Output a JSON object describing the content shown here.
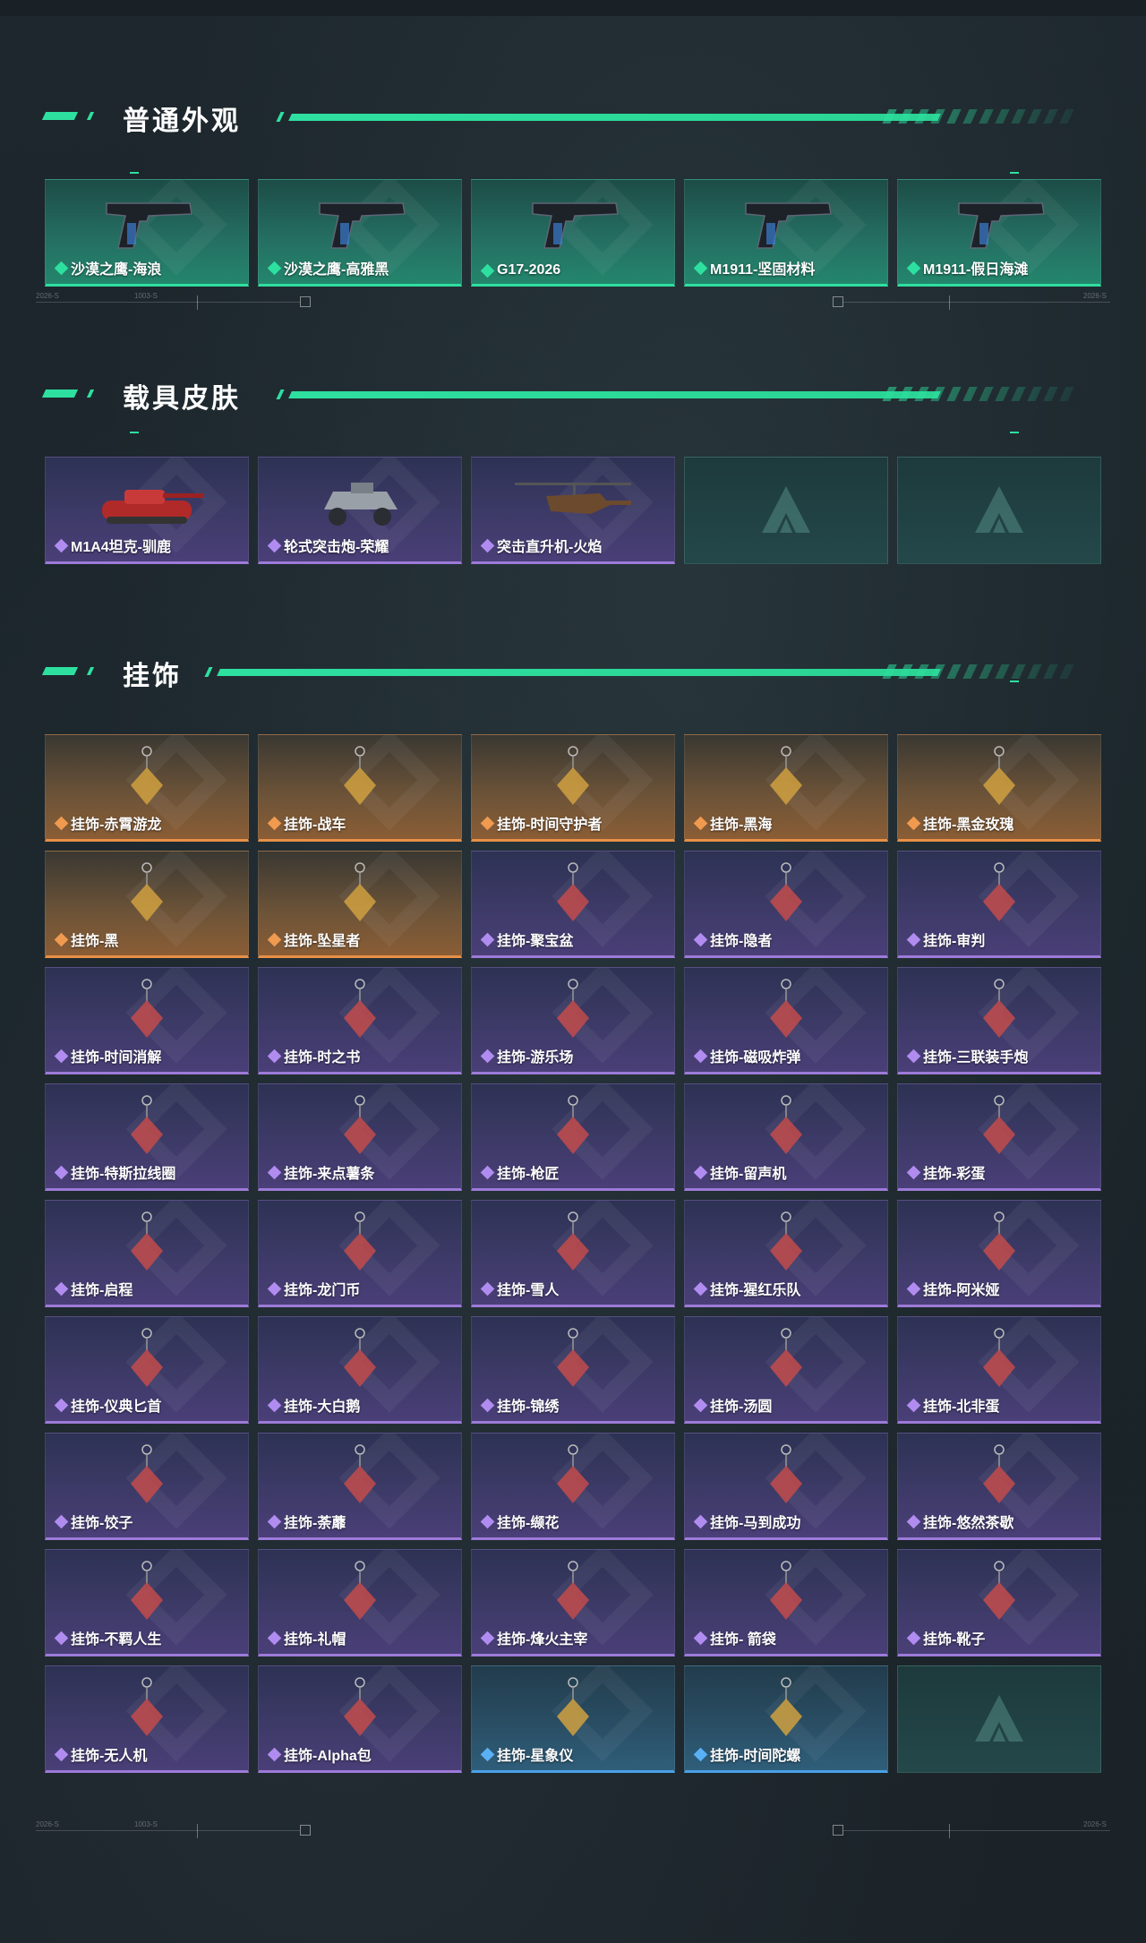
{
  "sections": [
    {
      "title": "普通外观",
      "items": [
        {
          "label": "沙漠之鹰-海浪",
          "rarity": "green",
          "icon": "pistol-icon"
        },
        {
          "label": "沙漠之鹰-高雅黑",
          "rarity": "green",
          "icon": "pistol-icon"
        },
        {
          "label": "G17-2026",
          "rarity": "green",
          "icon": "pistol-icon"
        },
        {
          "label": "M1911-坚固材料",
          "rarity": "green",
          "icon": "pistol-icon"
        },
        {
          "label": "M1911-假日海滩",
          "rarity": "green",
          "icon": "pistol-icon"
        }
      ]
    },
    {
      "title": "载具皮肤",
      "items": [
        {
          "label": "M1A4坦克-驯鹿",
          "rarity": "purple",
          "icon": "tank-icon"
        },
        {
          "label": "轮式突击炮-荣耀",
          "rarity": "purple",
          "icon": "vehicle-icon"
        },
        {
          "label": "突击直升机-火焰",
          "rarity": "purple",
          "icon": "helicopter-icon"
        },
        {
          "label": "",
          "rarity": "empty",
          "icon": "logo-icon"
        },
        {
          "label": "",
          "rarity": "empty",
          "icon": "logo-icon"
        }
      ]
    },
    {
      "title": "挂饰",
      "items": [
        {
          "label": "挂饰-赤霄游龙",
          "rarity": "orange",
          "icon": "charm-icon"
        },
        {
          "label": "挂饰-战车",
          "rarity": "orange",
          "icon": "charm-icon"
        },
        {
          "label": "挂饰-时间守护者",
          "rarity": "orange",
          "icon": "charm-icon"
        },
        {
          "label": "挂饰-黑海",
          "rarity": "orange",
          "icon": "charm-icon"
        },
        {
          "label": "挂饰-黑金玫瑰",
          "rarity": "orange",
          "icon": "charm-icon"
        },
        {
          "label": "挂饰-黑",
          "rarity": "orange",
          "icon": "charm-icon"
        },
        {
          "label": "挂饰-坠星者",
          "rarity": "orange",
          "icon": "charm-icon"
        },
        {
          "label": "挂饰-聚宝盆",
          "rarity": "purple",
          "icon": "charm-icon"
        },
        {
          "label": "挂饰-隐者",
          "rarity": "purple",
          "icon": "charm-icon"
        },
        {
          "label": "挂饰-审判",
          "rarity": "purple",
          "icon": "charm-icon"
        },
        {
          "label": "挂饰-时间消解",
          "rarity": "purple",
          "icon": "charm-icon"
        },
        {
          "label": "挂饰-时之书",
          "rarity": "purple",
          "icon": "charm-icon"
        },
        {
          "label": "挂饰-游乐场",
          "rarity": "purple",
          "icon": "charm-icon"
        },
        {
          "label": "挂饰-磁吸炸弹",
          "rarity": "purple",
          "icon": "charm-icon"
        },
        {
          "label": "挂饰-三联装手炮",
          "rarity": "purple",
          "icon": "charm-icon"
        },
        {
          "label": "挂饰-特斯拉线圈",
          "rarity": "purple",
          "icon": "charm-icon"
        },
        {
          "label": "挂饰-来点薯条",
          "rarity": "purple",
          "icon": "charm-icon"
        },
        {
          "label": "挂饰-枪匠",
          "rarity": "purple",
          "icon": "charm-icon"
        },
        {
          "label": "挂饰-留声机",
          "rarity": "purple",
          "icon": "charm-icon"
        },
        {
          "label": "挂饰-彩蛋",
          "rarity": "purple",
          "icon": "charm-icon"
        },
        {
          "label": "挂饰-启程",
          "rarity": "purple",
          "icon": "charm-icon"
        },
        {
          "label": "挂饰-龙门币",
          "rarity": "purple",
          "icon": "charm-icon"
        },
        {
          "label": "挂饰-雪人",
          "rarity": "purple",
          "icon": "charm-icon"
        },
        {
          "label": "挂饰-猩红乐队",
          "rarity": "purple",
          "icon": "charm-icon"
        },
        {
          "label": "挂饰-阿米娅",
          "rarity": "purple",
          "icon": "charm-icon"
        },
        {
          "label": "挂饰-仪典匕首",
          "rarity": "purple",
          "icon": "charm-icon"
        },
        {
          "label": "挂饰-大白鹅",
          "rarity": "purple",
          "icon": "charm-icon"
        },
        {
          "label": "挂饰-锦绣",
          "rarity": "purple",
          "icon": "charm-icon"
        },
        {
          "label": "挂饰-汤圆",
          "rarity": "purple",
          "icon": "charm-icon"
        },
        {
          "label": "挂饰-北非蛋",
          "rarity": "purple",
          "icon": "charm-icon"
        },
        {
          "label": "挂饰-饺子",
          "rarity": "purple",
          "icon": "charm-icon"
        },
        {
          "label": "挂饰-荼蘼",
          "rarity": "purple",
          "icon": "charm-icon"
        },
        {
          "label": "挂饰-缬花",
          "rarity": "purple",
          "icon": "charm-icon"
        },
        {
          "label": "挂饰-马到成功",
          "rarity": "purple",
          "icon": "charm-icon"
        },
        {
          "label": "挂饰-悠然茶歇",
          "rarity": "purple",
          "icon": "charm-icon"
        },
        {
          "label": "挂饰-不羁人生",
          "rarity": "purple",
          "icon": "charm-icon"
        },
        {
          "label": "挂饰-礼帽",
          "rarity": "purple",
          "icon": "charm-icon"
        },
        {
          "label": "挂饰-烽火主宰",
          "rarity": "purple",
          "icon": "charm-icon"
        },
        {
          "label": "挂饰- 箭袋",
          "rarity": "purple",
          "icon": "charm-icon"
        },
        {
          "label": "挂饰-靴子",
          "rarity": "purple",
          "icon": "charm-icon"
        },
        {
          "label": "挂饰-无人机",
          "rarity": "purple",
          "icon": "charm-icon"
        },
        {
          "label": "挂饰-Alpha包",
          "rarity": "purple",
          "icon": "charm-icon"
        },
        {
          "label": "挂饰-星象仪",
          "rarity": "blue",
          "icon": "charm-icon"
        },
        {
          "label": "挂饰-时间陀螺",
          "rarity": "blue",
          "icon": "charm-icon"
        },
        {
          "label": "",
          "rarity": "empty",
          "icon": "logo-icon"
        }
      ]
    }
  ],
  "colors": {
    "accent": "#2ee0a0",
    "green": "#2ee0a0",
    "purple": "#9d7ad8",
    "orange": "#e89047",
    "blue": "#4aa0e8"
  }
}
